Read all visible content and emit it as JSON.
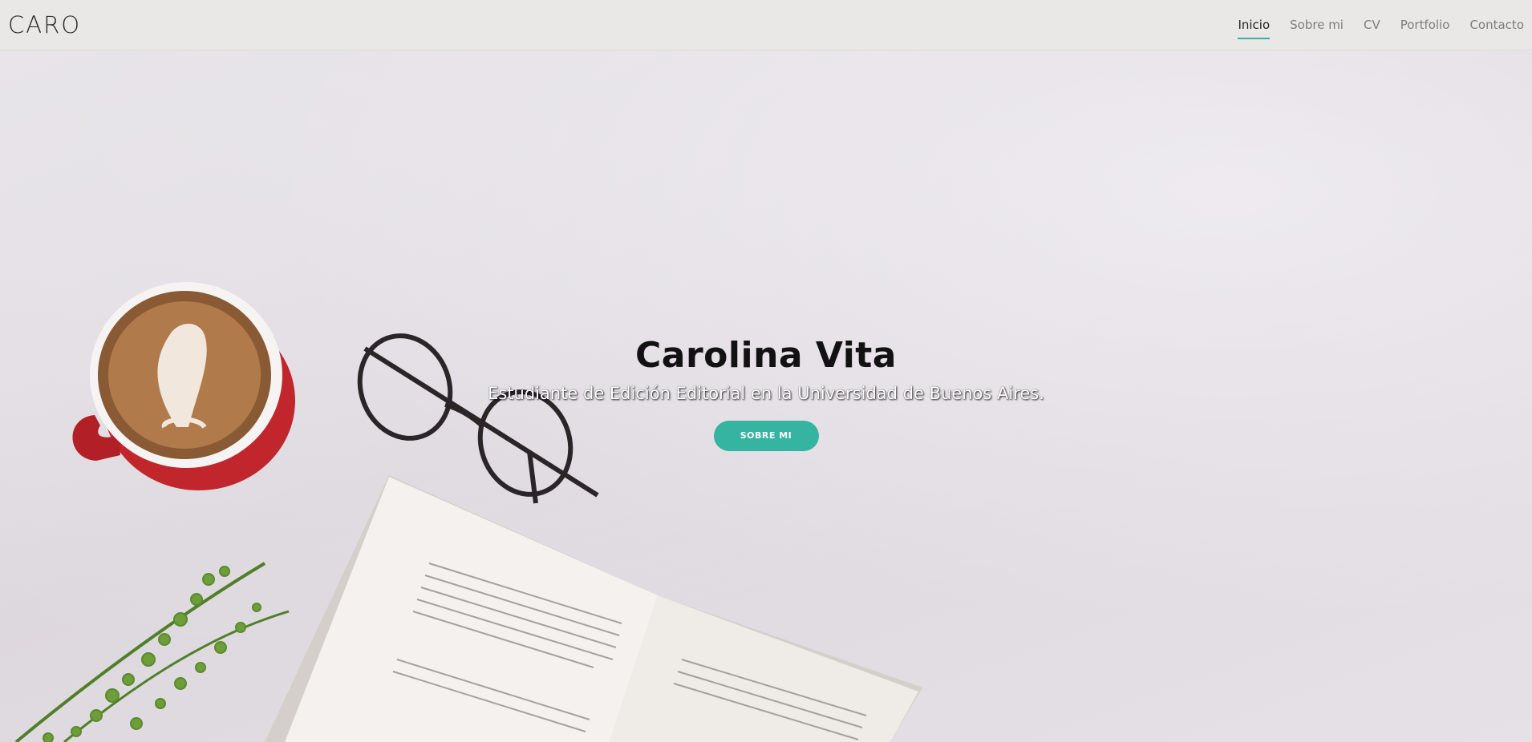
{
  "header": {
    "brand": "CARO",
    "nav": [
      {
        "label": "Inicio",
        "active": true
      },
      {
        "label": "Sobre mi",
        "active": false
      },
      {
        "label": "CV",
        "active": false
      },
      {
        "label": "Portfolio",
        "active": false
      },
      {
        "label": "Contacto",
        "active": false
      }
    ]
  },
  "hero": {
    "title": "Carolina Vita",
    "subtitle": "Estudiante de Edición Editorial en la Universidad de Buenos Aires.",
    "button_label": "SOBRE MI",
    "background_icons": [
      "coffee-cup-icon",
      "glasses-icon",
      "open-book-icon",
      "plant-icon"
    ]
  },
  "colors": {
    "accent": "#35b4a1",
    "navbar_bg": "#e9e8e6",
    "title": "#121212"
  }
}
